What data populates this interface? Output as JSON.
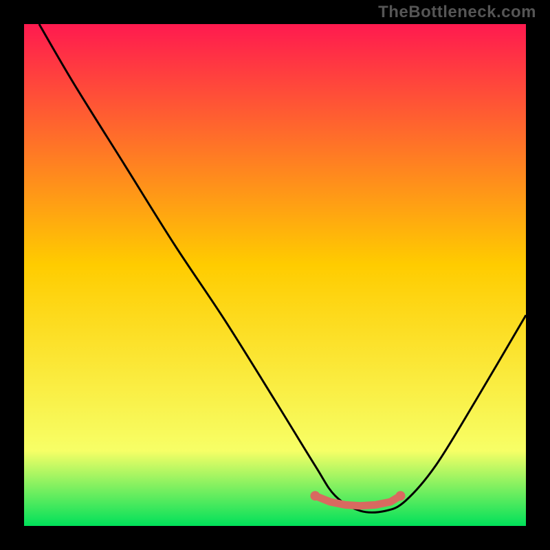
{
  "watermark": "TheBottleneck.com",
  "colors": {
    "bg": "#000000",
    "grad_top": "#ff1a4f",
    "grad_mid": "#ffcc00",
    "grad_low": "#f7ff66",
    "grad_bottom": "#00e05a",
    "curve": "#000000",
    "marker": "#d86a60"
  },
  "chart_data": {
    "type": "line",
    "title": "",
    "xlabel": "",
    "ylabel": "",
    "xlim": [
      0,
      100
    ],
    "ylim": [
      0,
      100
    ],
    "series": [
      {
        "name": "bottleneck-curve",
        "x": [
          3,
          10,
          20,
          30,
          40,
          50,
          58,
          62,
          67,
          72,
          76,
          82,
          90,
          100
        ],
        "values": [
          100,
          88,
          72,
          56,
          41,
          25,
          12,
          6,
          3,
          3,
          5,
          12,
          25,
          42
        ]
      }
    ],
    "markers": {
      "name": "optimal-range",
      "x": [
        58,
        61,
        64,
        67,
        70,
        73,
        75
      ],
      "values": [
        6,
        4.8,
        4.2,
        4,
        4.2,
        4.8,
        6
      ]
    }
  }
}
